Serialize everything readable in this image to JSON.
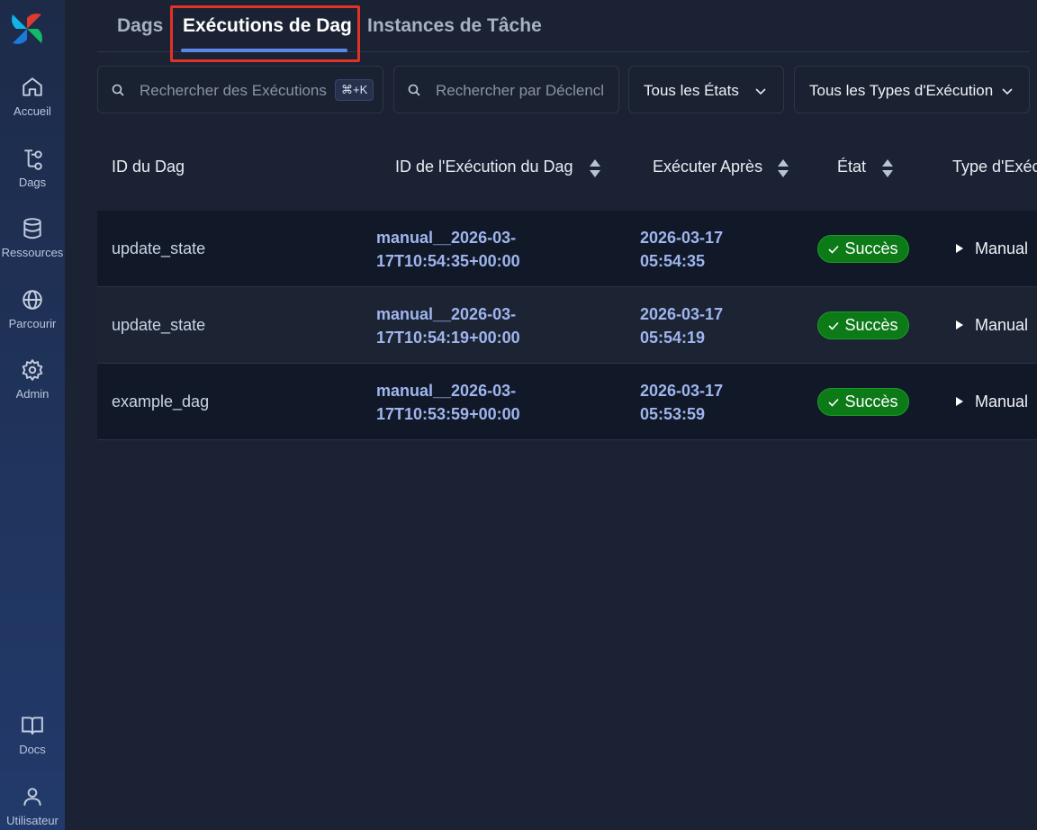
{
  "sidebar": {
    "items": [
      {
        "label": "Accueil",
        "icon": "home-icon"
      },
      {
        "label": "Dags",
        "icon": "dag-icon"
      },
      {
        "label": "Ressources",
        "icon": "database-icon"
      },
      {
        "label": "Parcourir",
        "icon": "globe-icon"
      },
      {
        "label": "Admin",
        "icon": "gear-icon"
      },
      {
        "label": "Docs",
        "icon": "book-icon"
      },
      {
        "label": "Utilisateur",
        "icon": "user-icon"
      }
    ]
  },
  "tabs": [
    {
      "label": "Dags",
      "active": false
    },
    {
      "label": "Exécutions de Dag",
      "active": true
    },
    {
      "label": "Instances de Tâche",
      "active": false
    }
  ],
  "filters": {
    "search_runs_placeholder": "Rechercher des Exécutions",
    "search_shortcut": "⌘+K",
    "search_trigger_placeholder": "Rechercher par Déclencl",
    "state_select": "Tous les États",
    "run_type_select": "Tous les Types d'Exécution"
  },
  "table": {
    "headers": [
      "ID du Dag",
      "ID de l'Exécution du Dag",
      "Exécuter Après",
      "État",
      "Type d'Exéc"
    ],
    "rows": [
      {
        "dag_id": "update_state",
        "run_id_1": "manual__2026-03-",
        "run_id_2": "17T10:54:35+00:00",
        "after_1": "2026-03-17",
        "after_2": "05:54:35",
        "state": "Succès",
        "run_type": "Manual"
      },
      {
        "dag_id": "update_state",
        "run_id_1": "manual__2026-03-",
        "run_id_2": "17T10:54:19+00:00",
        "after_1": "2026-03-17",
        "after_2": "05:54:19",
        "state": "Succès",
        "run_type": "Manual"
      },
      {
        "dag_id": "example_dag",
        "run_id_1": "manual__2026-03-",
        "run_id_2": "17T10:53:59+00:00",
        "after_1": "2026-03-17",
        "after_2": "05:53:59",
        "state": "Succès",
        "run_type": "Manual"
      }
    ]
  },
  "colors": {
    "background": "#1b2233",
    "sidebar": "#223a6b",
    "accent": "#5e86e6",
    "success": "#0d7a18",
    "highlight": "#e13325"
  }
}
